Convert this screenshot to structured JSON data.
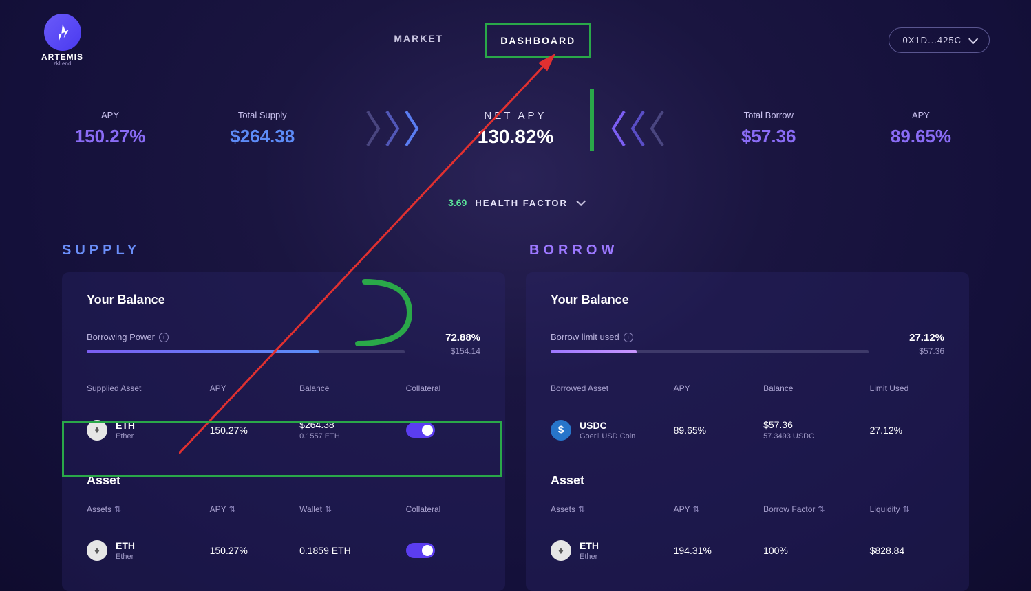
{
  "brand": {
    "name": "ARTEMIS",
    "sub": "zkLend"
  },
  "nav": {
    "market": "MARKET",
    "dashboard": "DASHBOARD"
  },
  "wallet": {
    "address": "0X1D...425C"
  },
  "stats": {
    "supply_apy_label": "APY",
    "supply_apy_value": "150.27%",
    "total_supply_label": "Total Supply",
    "total_supply_value": "$264.38",
    "net_apy_label": "NET APY",
    "net_apy_value": "130.82%",
    "total_borrow_label": "Total Borrow",
    "total_borrow_value": "$57.36",
    "borrow_apy_label": "APY",
    "borrow_apy_value": "89.65%"
  },
  "health": {
    "value": "3.69",
    "label": "HEALTH FACTOR"
  },
  "sections": {
    "supply": "SUPPLY",
    "borrow": "BORROW"
  },
  "supply_panel": {
    "title": "Your Balance",
    "bar_label": "Borrowing Power",
    "bar_pct": "72.88%",
    "bar_pct_num": 72.88,
    "bar_sub": "$154.14",
    "headers": {
      "asset": "Supplied Asset",
      "apy": "APY",
      "balance": "Balance",
      "collateral": "Collateral"
    },
    "row": {
      "icon": "eth",
      "symbol": "ETH",
      "name": "Ether",
      "apy": "150.27%",
      "balance": "$264.38",
      "balance_sub": "0.1557 ETH"
    },
    "asset_title": "Asset",
    "asset_headers": {
      "assets": "Assets",
      "apy": "APY",
      "wallet": "Wallet",
      "collateral": "Collateral"
    },
    "asset_row": {
      "icon": "eth",
      "symbol": "ETH",
      "name": "Ether",
      "apy": "150.27%",
      "wallet": "0.1859 ETH"
    }
  },
  "borrow_panel": {
    "title": "Your Balance",
    "bar_label": "Borrow limit used",
    "bar_pct": "27.12%",
    "bar_pct_num": 27.12,
    "bar_sub": "$57.36",
    "headers": {
      "asset": "Borrowed Asset",
      "apy": "APY",
      "balance": "Balance",
      "limit": "Limit Used"
    },
    "row": {
      "icon": "usdc",
      "symbol": "USDC",
      "name": "Goerli USD Coin",
      "apy": "89.65%",
      "balance": "$57.36",
      "balance_sub": "57.3493 USDC",
      "limit": "27.12%"
    },
    "asset_title": "Asset",
    "asset_headers": {
      "assets": "Assets",
      "apy": "APY",
      "factor": "Borrow Factor",
      "liquidity": "Liquidity"
    },
    "asset_row": {
      "icon": "eth",
      "symbol": "ETH",
      "name": "Ether",
      "apy": "194.31%",
      "factor": "100%",
      "liquidity": "$828.84"
    }
  }
}
